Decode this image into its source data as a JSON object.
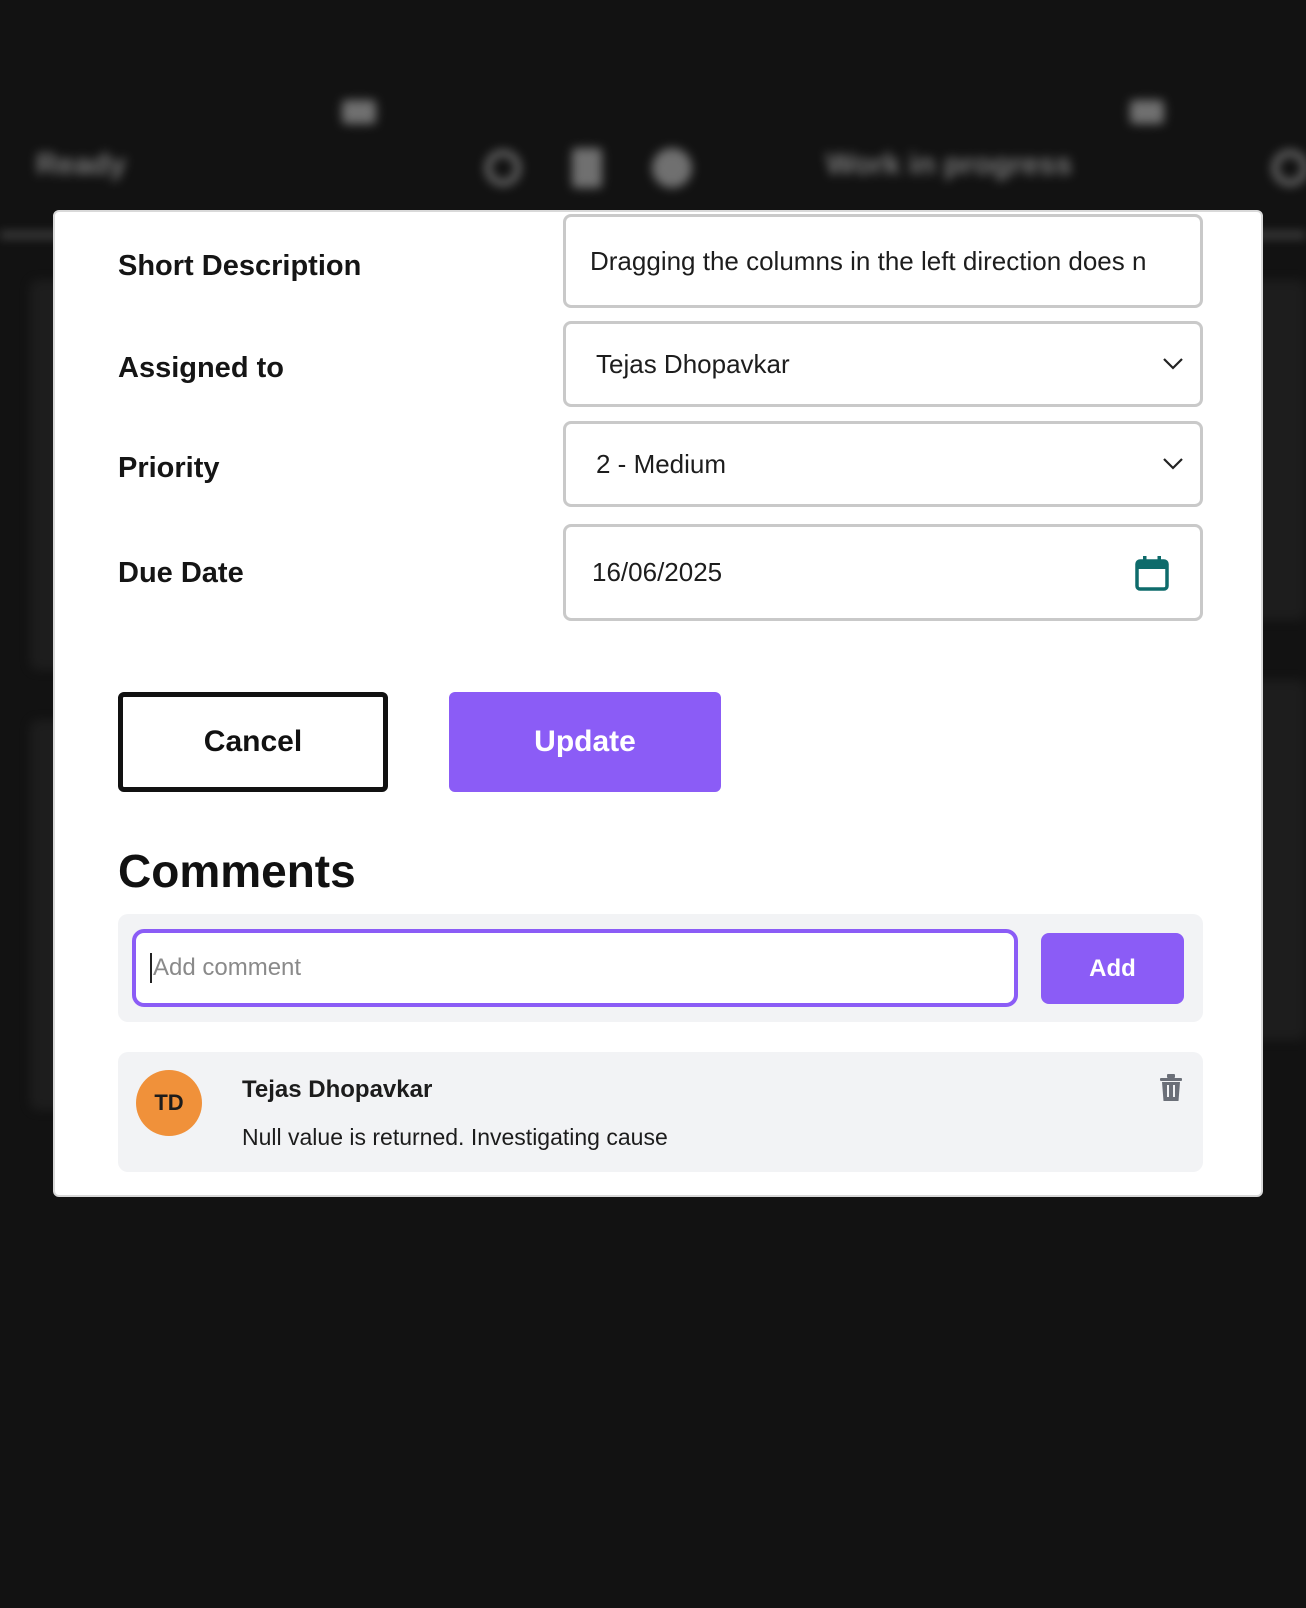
{
  "background": {
    "column_left_title": "Ready",
    "column_right_title": "Work in progress"
  },
  "form": {
    "short_description": {
      "label": "Short Description",
      "value": "Dragging the columns in the left direction does n"
    },
    "assigned_to": {
      "label": "Assigned to",
      "value": "Tejas Dhopavkar"
    },
    "priority": {
      "label": "Priority",
      "value": "2 - Medium"
    },
    "due_date": {
      "label": "Due Date",
      "value": "16/06/2025"
    }
  },
  "buttons": {
    "cancel": "Cancel",
    "update": "Update"
  },
  "comments": {
    "title": "Comments",
    "input_placeholder": "Add comment",
    "add_label": "Add",
    "items": [
      {
        "initials": "TD",
        "author": "Tejas Dhopavkar",
        "text": "Null value is returned. Investigating cause"
      }
    ]
  },
  "colors": {
    "accent": "#8b5cf6",
    "avatar": "#f0913a",
    "calendar_icon": "#0e6b6b",
    "overlay": "#121212"
  }
}
